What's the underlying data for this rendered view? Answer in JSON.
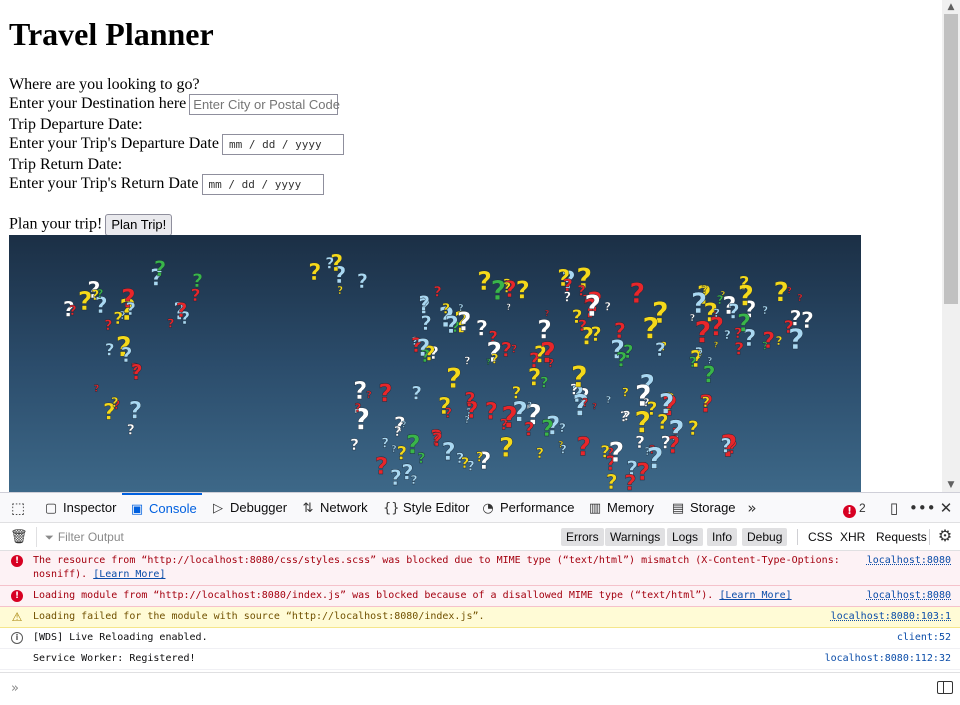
{
  "page": {
    "title": "Travel Planner",
    "destination_prompt": "Where are you looking to go?",
    "destination_label": "Enter your Destination here",
    "destination_placeholder": "Enter City or Postal Code",
    "departure_heading": "Trip Departure Date:",
    "departure_label": "Enter your Trip's Departure Date",
    "departure_value": "mm / dd / yyyy",
    "return_heading": "Trip Return Date:",
    "return_label": "Enter your Trip's Return Date",
    "return_value": "mm / dd / yyyy",
    "plan_prompt": "Plan your trip!",
    "plan_button": "Plan Trip!",
    "hero_image": "world-map-of-question-marks"
  },
  "devtools": {
    "tabs": [
      {
        "label": "Inspector",
        "icon": "inspector-icon"
      },
      {
        "label": "Console",
        "icon": "console-icon",
        "active": true
      },
      {
        "label": "Debugger",
        "icon": "debugger-icon"
      },
      {
        "label": "Network",
        "icon": "network-icon"
      },
      {
        "label": "Style Editor",
        "icon": "style-editor-icon"
      },
      {
        "label": "Performance",
        "icon": "performance-icon"
      },
      {
        "label": "Memory",
        "icon": "memory-icon"
      },
      {
        "label": "Storage",
        "icon": "storage-icon"
      }
    ],
    "error_count": "2",
    "filter_placeholder": "Filter Output",
    "levels": [
      "Errors",
      "Warnings",
      "Logs",
      "Info",
      "Debug"
    ],
    "extra_filters": [
      "CSS",
      "XHR",
      "Requests"
    ],
    "messages": [
      {
        "type": "error",
        "text": "The resource from “http://localhost:8080/css/styles.scss” was blocked due to MIME type (“text/html”) mismatch (X-Content-Type-Options: nosniff).",
        "link": "[Learn More]",
        "source": "localhost:8080"
      },
      {
        "type": "error",
        "text": "Loading module from “http://localhost:8080/index.js” was blocked because of a disallowed MIME type (“text/html”).",
        "link": "[Learn More]",
        "source": "localhost:8080"
      },
      {
        "type": "warn",
        "text": "Loading failed for the module with source “http://localhost:8080/index.js”.",
        "source": "localhost:8080:103:1"
      },
      {
        "type": "info",
        "text": "[WDS] Live Reloading enabled.",
        "source": "client:52"
      },
      {
        "type": "log",
        "text": "Service Worker: Registered!",
        "source": "localhost:8080:112:32"
      }
    ],
    "colors": {
      "accent": "#0060df",
      "error_bg": "#fdf2f5",
      "error_text": "#a4000f",
      "warn_bg": "#fffbd6"
    }
  }
}
